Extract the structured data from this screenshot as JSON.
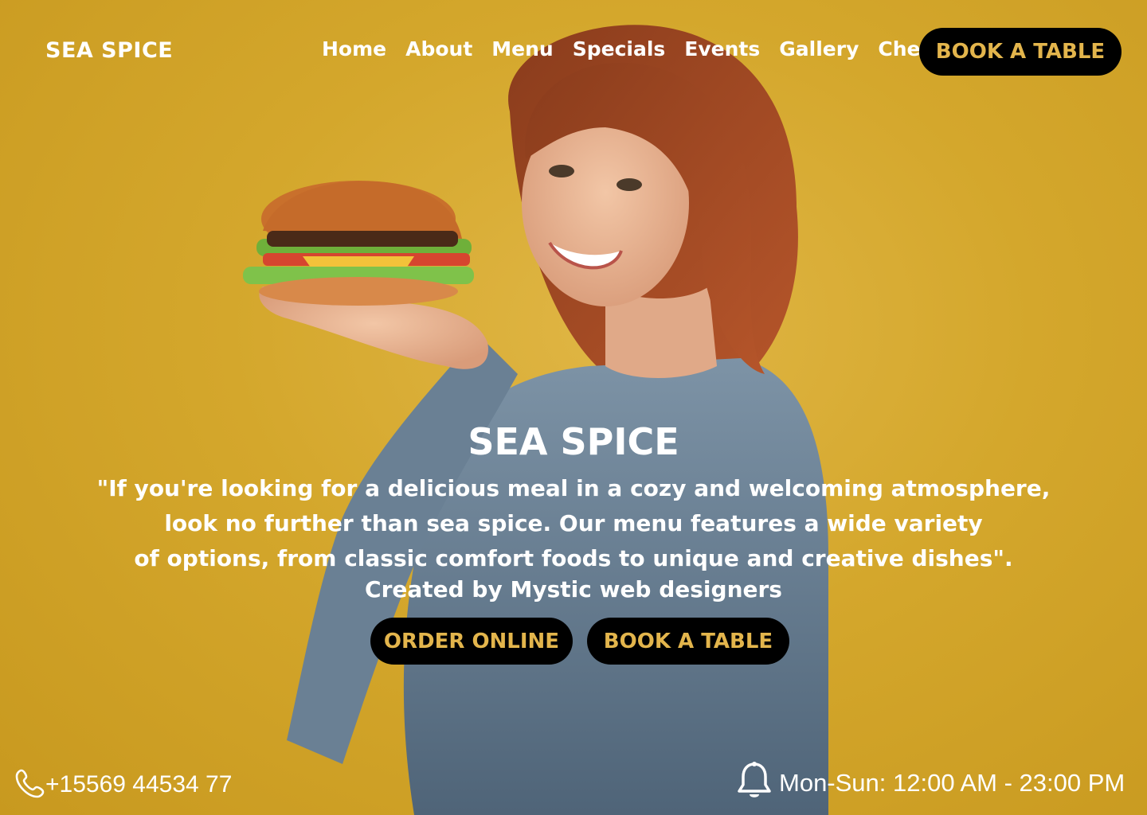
{
  "header": {
    "logo": "SEA SPICE",
    "nav": [
      "Home",
      "About",
      "Menu",
      "Specials",
      "Events",
      "Gallery",
      "Chefs"
    ],
    "book_label": "BOOK A TABLE"
  },
  "hero": {
    "title": "SEA SPICE",
    "quote_lines": [
      "\"If you're looking for a delicious meal in a cozy and welcoming atmosphere,",
      "look no further than sea spice. Our menu features a wide variety",
      "of options, from classic comfort foods to unique and creative dishes\"."
    ],
    "credit": "Created by Mystic web designers",
    "order_label": "ORDER ONLINE",
    "book_label": "BOOK A TABLE"
  },
  "contact": {
    "phone": "+15569 44534 77",
    "phone_icon": "phone-icon",
    "hours": "Mon-Sun: 12:00 AM - 23:00 PM",
    "hours_icon": "bell-icon"
  },
  "colors": {
    "background": "#d4a72c",
    "button_bg": "#000000",
    "button_text": "#e3b54c",
    "text": "#ffffff"
  }
}
